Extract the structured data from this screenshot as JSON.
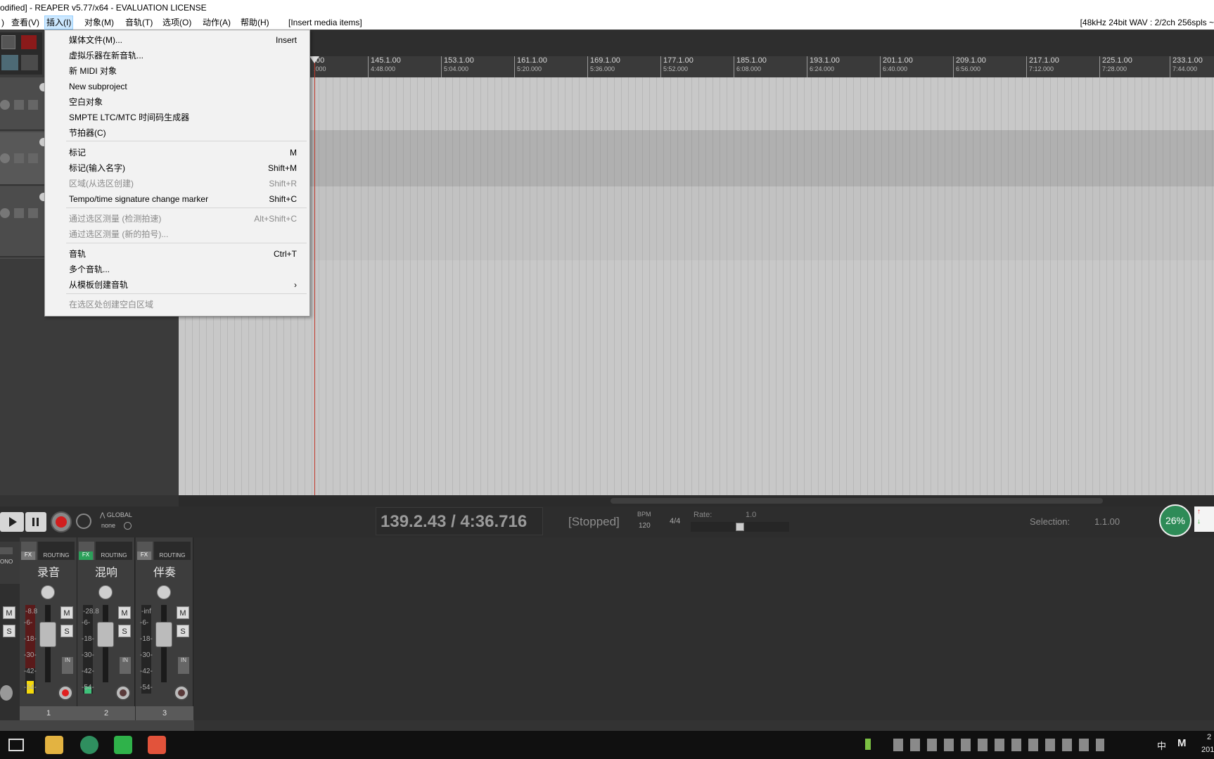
{
  "titlebar": {
    "title": "odified] - REAPER v5.77/x64 - EVALUATION LICENSE"
  },
  "menubar": {
    "items": [
      "查看(V)",
      "插入(I)",
      "对象(M)",
      "音轨(T)",
      "选项(O)",
      "动作(A)",
      "帮助(H)"
    ],
    "context_label": "[Insert media items]",
    "status_right": "[48kHz 24bit WAV : 2/2ch 256spls ~"
  },
  "ruler": {
    "ticks": [
      {
        "bar": "145.1.00",
        "time": "4:48.000"
      },
      {
        "bar": "153.1.00",
        "time": "5:04.000"
      },
      {
        "bar": "161.1.00",
        "time": "5:20.000"
      },
      {
        "bar": "169.1.00",
        "time": "5:36.000"
      },
      {
        "bar": "177.1.00",
        "time": "5:52.000"
      },
      {
        "bar": "185.1.00",
        "time": "6:08.000"
      },
      {
        "bar": "193.1.00",
        "time": "6:24.000"
      },
      {
        "bar": "201.1.00",
        "time": "6:40.000"
      },
      {
        "bar": "209.1.00",
        "time": "6:56.000"
      },
      {
        "bar": "217.1.00",
        "time": "7:12.000"
      },
      {
        "bar": "225.1.00",
        "time": "7:28.000"
      },
      {
        "bar": "233.1.00",
        "time": "7:44.000"
      }
    ],
    "partial_left": ".00",
    "partial_left_sub": ".000"
  },
  "dropdown": {
    "items": [
      {
        "label": "媒体文件(M)...",
        "shortcut": "Insert",
        "disabled": false
      },
      {
        "label": "虚拟乐器在新音轨...",
        "shortcut": "",
        "disabled": false
      },
      {
        "label": "新 MIDI 对象",
        "shortcut": "",
        "disabled": false
      },
      {
        "label": "New subproject",
        "shortcut": "",
        "disabled": false
      },
      {
        "label": "空白对象",
        "shortcut": "",
        "disabled": false
      },
      {
        "label": "SMPTE LTC/MTC 时间码生成器",
        "shortcut": "",
        "disabled": false
      },
      {
        "label": "节拍器(C)",
        "shortcut": "",
        "disabled": false
      },
      {
        "label": "标记",
        "shortcut": "M",
        "disabled": false
      },
      {
        "label": "标记(输入名字)",
        "shortcut": "Shift+M",
        "disabled": false
      },
      {
        "label": "区域(从选区创建)",
        "shortcut": "Shift+R",
        "disabled": true
      },
      {
        "label": "Tempo/time signature change marker",
        "shortcut": "Shift+C",
        "disabled": false
      },
      {
        "label": "通过选区测量 (检测拍速)",
        "shortcut": "Alt+Shift+C",
        "disabled": true
      },
      {
        "label": "通过选区测量 (新的拍号)...",
        "shortcut": "",
        "disabled": true
      },
      {
        "label": "音轨",
        "shortcut": "Ctrl+T",
        "disabled": false
      },
      {
        "label": "多个音轨...",
        "shortcut": "",
        "disabled": false
      },
      {
        "label": "从模板创建音轨",
        "shortcut": "›",
        "disabled": false
      },
      {
        "label": "在选区处创建空白区域",
        "shortcut": "",
        "disabled": true
      }
    ]
  },
  "transport": {
    "position": "139.2.43 / 4:36.716",
    "state": "[Stopped]",
    "bpm_label": "BPM",
    "bpm": "120",
    "timesig": "4/4",
    "rate_label": "Rate:",
    "rate": "1.0",
    "selection_label": "Selection:",
    "selection": "1.1.00",
    "global_label": "GLOBAL",
    "global_value": "none",
    "cpu": "26%"
  },
  "mixer": {
    "strips": [
      {
        "name": "录音",
        "num": "1",
        "db": "-8.8",
        "fx_label": "FX",
        "routing": "ROUTING"
      },
      {
        "name": "混响",
        "num": "2",
        "db": "-28.8",
        "fx_label": "FX",
        "routing": "ROUTING"
      },
      {
        "name": "伴奏",
        "num": "3",
        "db": "-inf",
        "fx_label": "FX",
        "routing": "ROUTING"
      }
    ],
    "scale": [
      "-6-",
      "-18-",
      "-30-",
      "-42-",
      "-54-"
    ],
    "mono_label": "ONO",
    "m_label": "M",
    "s_label": "S",
    "in_label": "IN"
  },
  "taskbar": {
    "ime": "中",
    "ime2": "M",
    "clock_partial": "2",
    "clock_partial2": "201"
  },
  "colors": {
    "record": "#d11e1e",
    "cpu_badge": "#2e8b57",
    "meter": "#f5d90a",
    "accent": "#3a9bd5"
  }
}
